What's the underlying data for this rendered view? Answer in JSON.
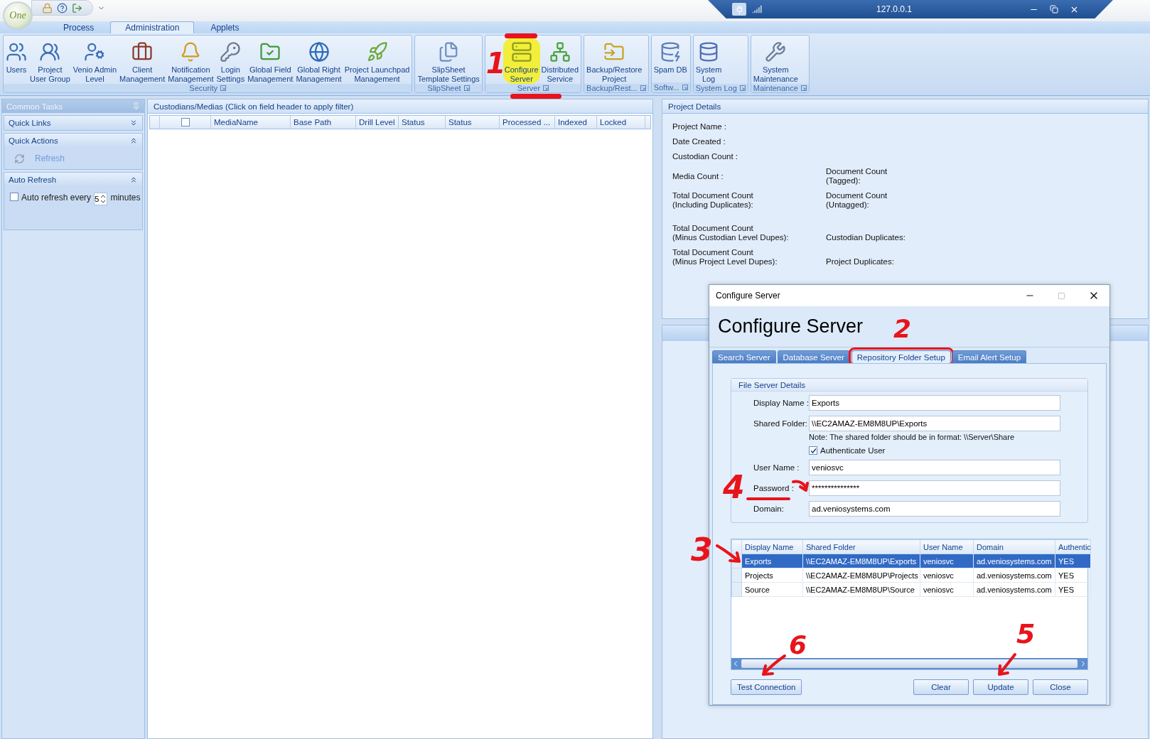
{
  "app": {
    "logo": "One"
  },
  "window": {
    "title": "127.0.0.1"
  },
  "ribbon_tabs": [
    {
      "label": "Process",
      "selected": false
    },
    {
      "label": "Administration",
      "selected": true
    },
    {
      "label": "Applets",
      "selected": false
    }
  ],
  "ribbon_groups": [
    {
      "label": "Security",
      "items": [
        {
          "lines": [
            "Users"
          ],
          "highlighted": false
        },
        {
          "lines": [
            "Project",
            "User Group"
          ],
          "highlighted": false
        },
        {
          "lines": [
            "Venio Admin",
            "Level"
          ],
          "highlighted": false
        },
        {
          "lines": [
            "Client",
            "Management"
          ],
          "highlighted": false
        },
        {
          "lines": [
            "Notification",
            "Management"
          ],
          "highlighted": false
        },
        {
          "lines": [
            "Login",
            "Settings"
          ],
          "highlighted": false
        },
        {
          "lines": [
            "Global Field",
            "Management"
          ],
          "highlighted": false
        },
        {
          "lines": [
            "Global Right",
            "Management"
          ],
          "highlighted": false
        },
        {
          "lines": [
            "Project Launchpad",
            "Management"
          ],
          "highlighted": false
        }
      ]
    },
    {
      "label": "SlipSheet",
      "items": [
        {
          "lines": [
            "SlipSheet",
            "Template Settings"
          ],
          "highlighted": false
        }
      ]
    },
    {
      "label": "Server",
      "items": [
        {
          "lines": [
            "Configure",
            "Server"
          ],
          "highlighted": true
        },
        {
          "lines": [
            "Distributed",
            "Service"
          ],
          "highlighted": false
        }
      ]
    },
    {
      "label": "Backup/Rest...",
      "items": [
        {
          "lines": [
            "Backup/Restore",
            "Project"
          ],
          "highlighted": false
        }
      ]
    },
    {
      "label": "Softw...",
      "items": [
        {
          "lines": [
            "Spam DB"
          ],
          "highlighted": false
        }
      ]
    },
    {
      "label": "System Log",
      "items": [
        {
          "lines": [
            "System",
            "Log"
          ],
          "highlighted": false
        }
      ]
    },
    {
      "label": "Maintenance",
      "items": [
        {
          "lines": [
            "System",
            "Maintenance"
          ],
          "highlighted": false
        }
      ]
    }
  ],
  "common_tasks": {
    "title": "Common Tasks",
    "sections": [
      {
        "title": "Quick Links",
        "expanded": false
      },
      {
        "kind": "actions",
        "title": "Quick Actions",
        "expanded": true,
        "items": [
          "Refresh"
        ]
      },
      {
        "kind": "auto",
        "title": "Auto Refresh",
        "expanded": true,
        "checked": false,
        "label": "Auto refresh every",
        "value": "5",
        "unit": "minutes"
      }
    ]
  },
  "media_panel": {
    "title": "Custodians/Medias (Click on field header to apply filter)",
    "select_all_checked": false,
    "columns": [
      "MediaName",
      "Base Path",
      "Drill Level",
      "Status",
      "Status",
      "Processed ...",
      "Indexed",
      "Locked"
    ]
  },
  "project_details": {
    "title": "Project Details",
    "rows": [
      {
        "left": [
          "Project Name :"
        ]
      },
      {
        "left": [
          "Date Created :"
        ]
      },
      {
        "left": [
          "Custodian Count :"
        ]
      },
      {
        "left": [
          "Media Count :"
        ],
        "right": [
          "Document Count",
          "(Tagged):"
        ]
      },
      {
        "left": [
          "Total Document Count",
          "(Including Duplicates):"
        ],
        "right": [
          "Document Count",
          "(Untagged):"
        ]
      },
      {
        "left": [
          "Total Document Count",
          "(Minus Custodian Level Dupes):"
        ],
        "right": [
          "Custodian Duplicates:"
        ]
      },
      {
        "left": [
          "Total Document Count",
          "(Minus Project Level Dupes):"
        ],
        "right": [
          "Project Duplicates:"
        ]
      }
    ]
  },
  "dialog": {
    "title": "Configure Server",
    "heading": "Configure Server",
    "tabs": [
      {
        "label": "Search Server",
        "selected": false,
        "circled": false
      },
      {
        "label": "Database Server",
        "selected": false,
        "circled": false
      },
      {
        "label": "Repository Folder Setup",
        "selected": true,
        "circled": true
      },
      {
        "label": "Email Alert Setup",
        "selected": false,
        "circled": false
      }
    ],
    "group_title": "File Server Details",
    "display_name": {
      "label": "Display Name :",
      "value": "Exports"
    },
    "shared_folder": {
      "label": "Shared Folder:",
      "value": "\\\\EC2AMAZ-EM8M8UP\\Exports"
    },
    "note": "Note: The shared folder should be in format: \\\\Server\\Share",
    "authenticate": {
      "label": "Authenticate User",
      "checked": true
    },
    "user_name": {
      "label": "User Name :",
      "value": "veniosvc"
    },
    "password": {
      "label": "Password :",
      "value": "***************"
    },
    "domain": {
      "label": "Domain:",
      "value": "ad.veniosystems.com"
    },
    "grid": {
      "columns": [
        "Display Name",
        "Shared Folder",
        "User Name",
        "Domain",
        "Authentic"
      ],
      "rows": [
        {
          "selected": true,
          "cells": [
            "Exports",
            "\\\\EC2AMAZ-EM8M8UP\\Exports",
            "veniosvc",
            "ad.veniosystems.com",
            "YES"
          ]
        },
        {
          "selected": false,
          "cells": [
            "Projects",
            "\\\\EC2AMAZ-EM8M8UP\\Projects",
            "veniosvc",
            "ad.veniosystems.com",
            "YES"
          ]
        },
        {
          "selected": false,
          "cells": [
            "Source",
            "\\\\EC2AMAZ-EM8M8UP\\Source",
            "veniosvc",
            "ad.veniosystems.com",
            "YES"
          ]
        }
      ]
    },
    "buttons": [
      "Test Connection",
      "Clear",
      "Update",
      "Close"
    ]
  },
  "annotations": [
    {
      "label": "1"
    },
    {
      "label": "2"
    },
    {
      "label": "3",
      "arrow": true
    },
    {
      "label": "4",
      "arrow": true
    },
    {
      "label": "5",
      "arrow": true
    },
    {
      "label": "6",
      "arrow": true
    }
  ]
}
